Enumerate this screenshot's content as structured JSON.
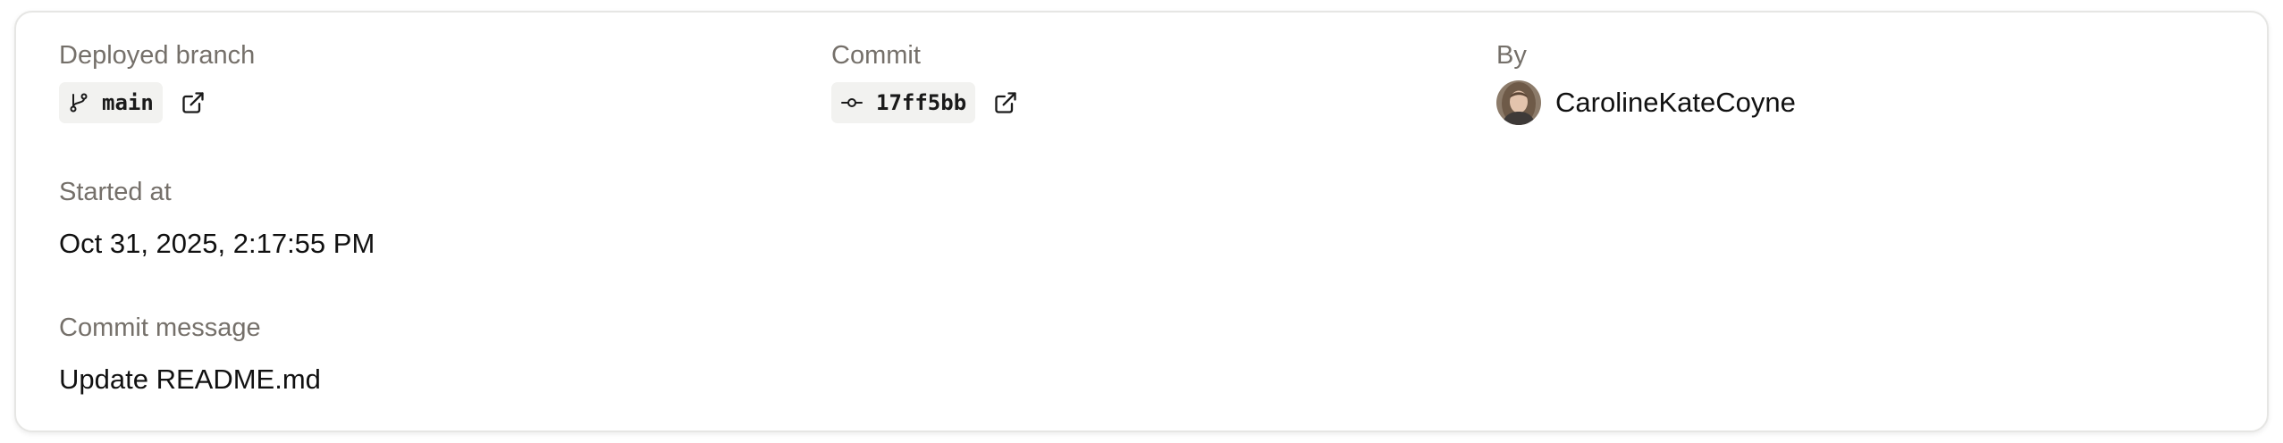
{
  "deployed_branch": {
    "label": "Deployed branch",
    "value": "main",
    "icon": "git-branch-icon",
    "link_icon": "external-link-icon"
  },
  "commit": {
    "label": "Commit",
    "value": "17ff5bb",
    "icon": "git-commit-icon",
    "link_icon": "external-link-icon"
  },
  "by": {
    "label": "By",
    "value": "CarolineKateCoyne",
    "icon": "avatar"
  },
  "started_at": {
    "label": "Started at",
    "value": "Oct 31, 2025, 2:17:55 PM"
  },
  "commit_message": {
    "label": "Commit message",
    "value": "Update README.md"
  },
  "colors": {
    "label": "#75706a",
    "value": "#111111",
    "chip_background": "#f2f2f0",
    "card_border": "#e6e6e4"
  }
}
